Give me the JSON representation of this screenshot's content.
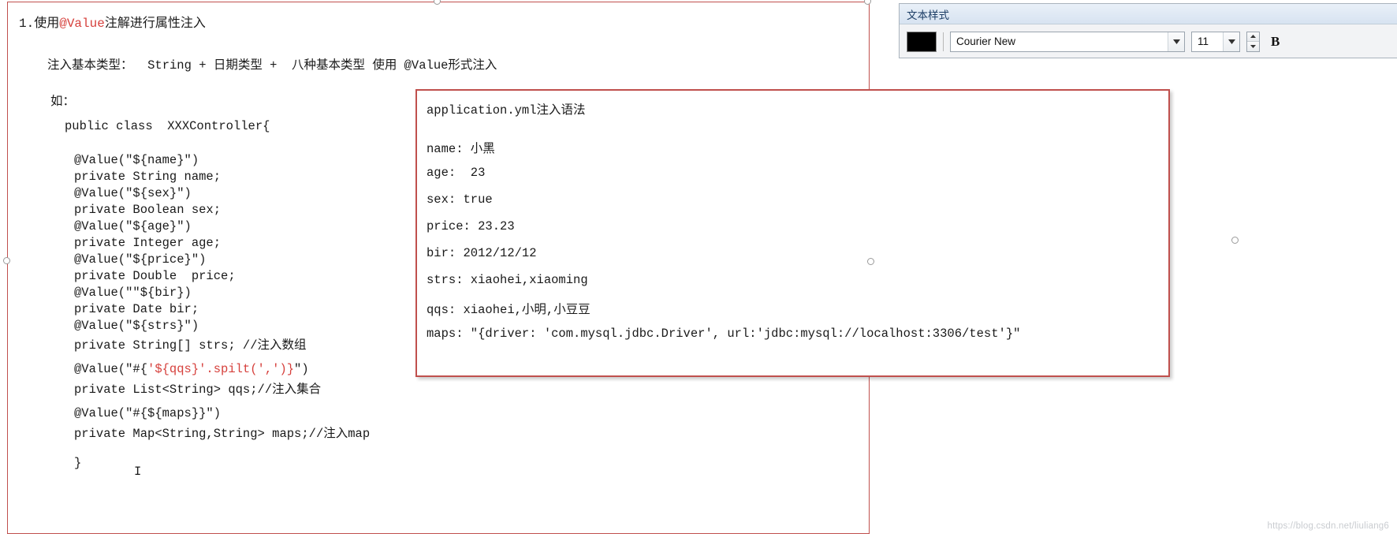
{
  "slide": {
    "heading_prefix": "1.使用",
    "heading_at_value": "@Value",
    "heading_suffix": "注解进行属性注入",
    "subtitle": "注入基本类型：  String + 日期类型 +  八种基本类型 使用 @Value形式注入",
    "example_label": "如：",
    "code_lines": [
      "public class  XXXController{",
      "@Value(\"${name}\")",
      "private String name;",
      "@Value(\"${sex}\")",
      "private Boolean sex;",
      "@Value(\"${age}\")",
      "private Integer age;",
      "@Value(\"${price}\")",
      "private Double  price;",
      "@Value(\"\"${bir})",
      "private Date bir;",
      "@Value(\"${strs}\")",
      "private String[] strs; //注入数组",
      "@Value(\"#{'${qqs}'.spilt(',')}\")",
      "private List<String> qqs;//注入集合",
      "@Value(\"#{${maps}}\")",
      "private Map<String,String> maps;//注入map",
      "}",
      "I"
    ],
    "code_red_line_1": "@Value(\"${name}\")",
    "code_line_qqs_prefix": "@Value(\"#{",
    "code_line_qqs_red": "'${qqs}'.spilt(',')}",
    "code_line_qqs_suffix": "\")"
  },
  "yml_callout": {
    "title": "application.yml注入语法",
    "lines": [
      "name: 小黑",
      "age:  23",
      "sex: true",
      "price: 23.23",
      "bir: 2012/12/12",
      "strs: xiaohei,xiaoming",
      "qqs: xiaohei,小明,小豆豆",
      "maps: \"{driver: 'com.mysql.jdbc.Driver', url:'jdbc:mysql://localhost:3306/test'}\""
    ]
  },
  "text_style_panel": {
    "title": "文本样式",
    "color_swatch": "#000000",
    "font_family_value": "Courier New",
    "font_size_value": "11",
    "bold_label": "B"
  },
  "watermark": "https://blog.csdn.net/liuliang6",
  "colors": {
    "selection_border": "#c0504d",
    "code_accent_red": "#d6403c",
    "panel_title_text": "#1d3e66"
  }
}
